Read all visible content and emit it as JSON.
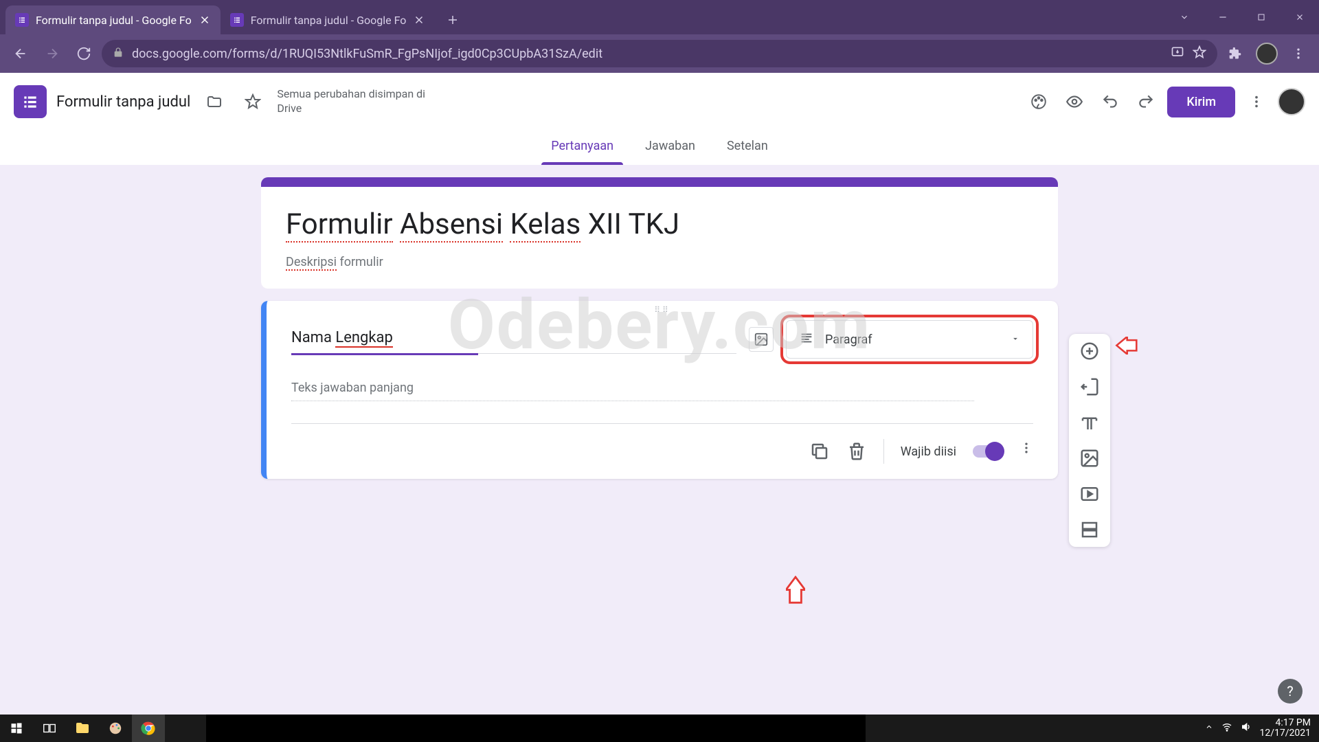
{
  "browser": {
    "tabs": [
      {
        "title": "Formulir tanpa judul - Google Fo",
        "active": true
      },
      {
        "title": "Formulir tanpa judul - Google Fo",
        "active": false
      }
    ],
    "url": "docs.google.com/forms/d/1RUQI53NtlkFuSmR_FgPsNIjof_igd0Cp3CUpbA31SzA/edit"
  },
  "header": {
    "form_name": "Formulir tanpa judul",
    "save_status": "Semua perubahan disimpan di Drive",
    "send_label": "Kirim"
  },
  "tabs": {
    "questions": "Pertanyaan",
    "responses": "Jawaban",
    "settings": "Setelan"
  },
  "form": {
    "title_words": [
      "Formulir",
      "Absensi",
      "Kelas"
    ],
    "title_plain": " XII TKJ",
    "description_word": "Deskripsi",
    "description_rest": " formulir"
  },
  "question": {
    "text_prefix": "Nama ",
    "text_spell": "Lengkap",
    "type_label": "Paragraf",
    "answer_placeholder": "Teks jawaban panjang",
    "required_label": "Wajib diisi"
  },
  "watermark": "Odebery.com",
  "taskbar": {
    "time": "4:17 PM",
    "date": "12/17/2021"
  }
}
